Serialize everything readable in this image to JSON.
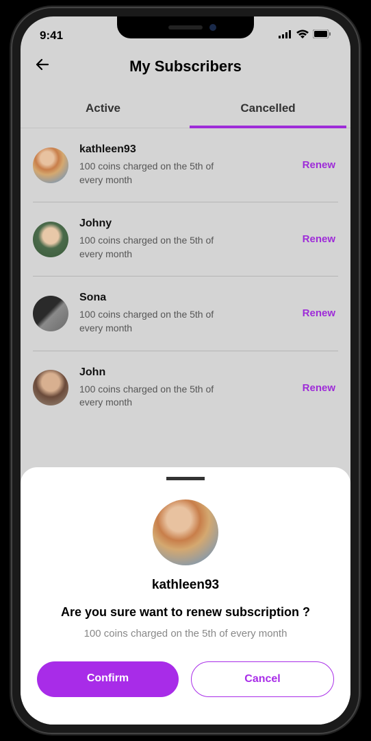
{
  "statusBar": {
    "time": "9:41"
  },
  "header": {
    "title": "My Subscribers"
  },
  "tabs": {
    "active": "Active",
    "cancelled": "Cancelled"
  },
  "subscribers": [
    {
      "name": "kathleen93",
      "desc": "100 coins charged on the 5th of every month",
      "action": "Renew"
    },
    {
      "name": "Johny",
      "desc": "100 coins charged on the 5th of every month",
      "action": "Renew"
    },
    {
      "name": "Sona",
      "desc": "100 coins charged on the 5th of every month",
      "action": "Renew"
    },
    {
      "name": "John",
      "desc": "100 coins charged on the 5th of every month",
      "action": "Renew"
    }
  ],
  "sheet": {
    "name": "kathleen93",
    "question": "Are you sure want to renew subscription ?",
    "desc": "100 coins charged on the 5th of every month",
    "confirm": "Confirm",
    "cancel": "Cancel"
  }
}
